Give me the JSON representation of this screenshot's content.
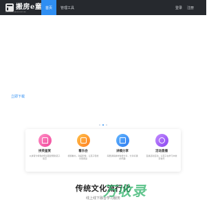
{
  "header": {
    "logo_text": "搬房e童书",
    "logo_sub": "ENGLISH HOUSE BOOKSTORE",
    "nav": [
      "首页",
      "管理工具"
    ],
    "nav_right": [
      "登录",
      "注册"
    ]
  },
  "hero": {
    "download_label": "立即下载"
  },
  "features": [
    {
      "icon": "house-icon",
      "title": "拼英鉴赏",
      "desc": "以拼音为特色的知识图谱帮助孩子鉴赏"
    },
    {
      "icon": "tv-icon",
      "title": "看乐会",
      "desc": "视频看书，动画影像，让孩子轻松享受阅读"
    },
    {
      "icon": "gift-icon",
      "title": "讲稿分享",
      "desc": "海量讲稿素材免费分享，分享好课的乐趣"
    },
    {
      "icon": "camera-icon",
      "title": "活动直播",
      "desc": "直播活动互动，让孩子在学习中收获快乐"
    }
  ],
  "promo": {
    "title": "传统文化流行化",
    "subtitle": "线上线下融合学习服务"
  },
  "watermark": "万收录",
  "colors": {
    "accent": "#2f8ef2",
    "topbar": "#26292e"
  }
}
